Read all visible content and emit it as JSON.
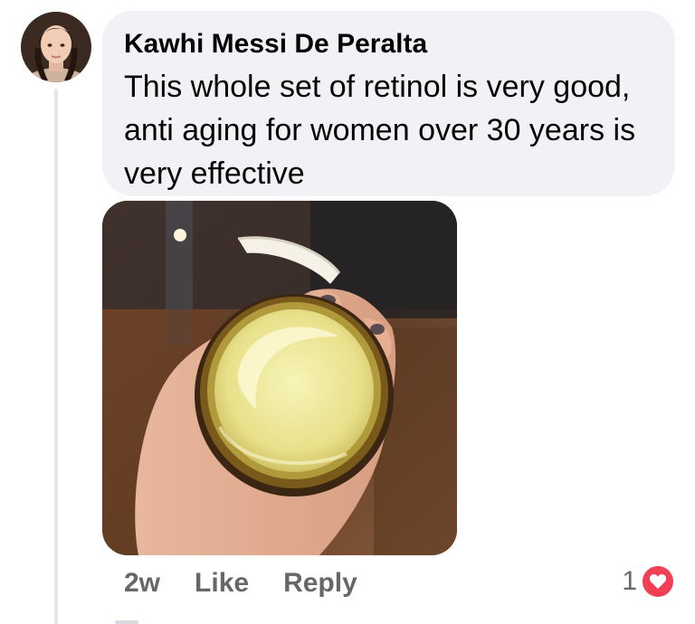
{
  "comment": {
    "author": "Kawhi Messi De Peralta",
    "text": "This whole set of retinol is very good, anti aging for women over 30 years is very effective",
    "timestamp": "2w",
    "like_label": "Like",
    "reply_label": "Reply",
    "reaction_count": "1",
    "reaction_icon": "heart-icon"
  },
  "colors": {
    "bubble": "#f0f2f5",
    "secondary_text": "#65676b",
    "primary_text": "#050505",
    "heart": "#f33e58"
  }
}
